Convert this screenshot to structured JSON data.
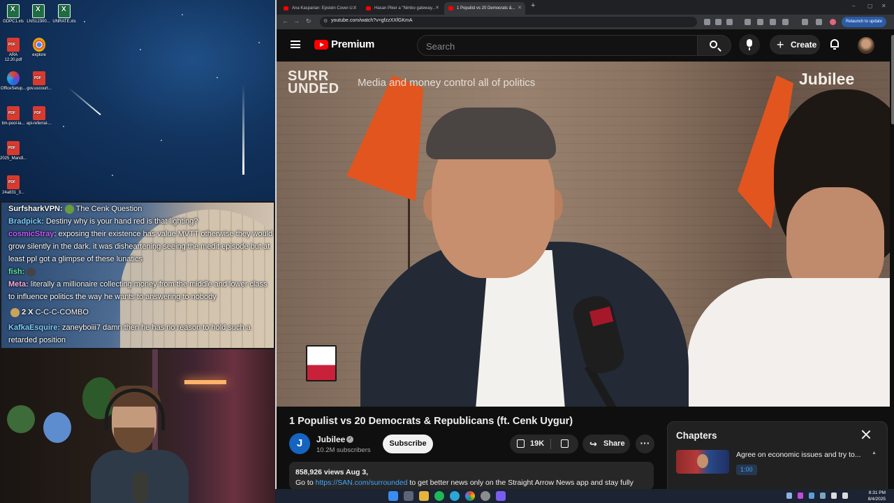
{
  "desktop": {
    "icons": [
      {
        "label": "GDPC1.xls",
        "type": "excel"
      },
      {
        "label": "LNS12300...",
        "type": "excel"
      },
      {
        "label": "UNRATE.xls",
        "type": "excel"
      },
      {
        "label": "ARA 12.20.pdf",
        "type": "pdf"
      },
      {
        "label": "explore",
        "type": "chrome"
      },
      {
        "label": "OfficeSetup...",
        "type": "office"
      },
      {
        "label": "gov.uscourt...",
        "type": "pdf"
      },
      {
        "label": "tim-pool-la...",
        "type": "pdf"
      },
      {
        "label": "api-referral-...",
        "type": "pdf"
      },
      {
        "label": "2025_Mandl...",
        "type": "pdf"
      },
      {
        "label": "24a831_3...",
        "type": "pdf"
      }
    ]
  },
  "chat": {
    "messages": [
      {
        "user": "SurfsharkVPN:",
        "user_color": "#ffffff",
        "text": "The Cenk Question",
        "emote": true
      },
      {
        "user": "Bradpick:",
        "user_color": "#7fd0ff",
        "text": "Destiny why is your hand red is that lighting?"
      },
      {
        "user": "cosmicStray",
        "user_color": "#c35cff",
        "text": ": exposing their existence has value MVTT otherwise they would grow silently in the dark. it was disheartening seeing the medit episode but at least ppl got a glimpse of these lunatics"
      },
      {
        "user": "fish:",
        "user_color": "#63e6a6",
        "text": "",
        "emote": true
      },
      {
        "user": "Meta:",
        "user_color": "#ffb0e0",
        "text": "literally a millionaire collecting money from the middle and lower class to influence politics the way he wants to answering to nobody"
      },
      {
        "user": "2 X",
        "user_color": "#ffffff",
        "text": "C-C-C-COMBO",
        "emote": true
      },
      {
        "user": "KafkaEsquire:",
        "user_color": "#7fd0ff",
        "text": "zaneyboiii7 damn then he has no reason to hold such a retarded position"
      }
    ]
  },
  "browser": {
    "tabs": [
      {
        "title": "Ana Kasparian: Epstein Cover-U...",
        "active": false
      },
      {
        "title": "Hasan Piker a \"Nimbo gateway...",
        "active": false
      },
      {
        "title": "1 Populist vs 20 Democrats &...",
        "active": true
      }
    ],
    "new_tab_label": "+",
    "url": "youtube.com/watch?v=gfzzXXfGKmA",
    "relaunch_label": "Relaunch to update"
  },
  "youtube": {
    "logo_text": "Premium",
    "search_placeholder": "Search",
    "create_label": "Create",
    "video": {
      "watermark_left": "SURR\nUNDED",
      "caption_overlay": "Media and money control all of politics",
      "watermark_right": "Jubilee",
      "mic_flag_text": "SURR UNDED"
    },
    "title": "1 Populist vs 20 Democrats & Republicans (ft. Cenk Uygur)",
    "channel": {
      "name": "Jubilee",
      "avatar_letter": "J",
      "subscribers": "10.2M subscribers"
    },
    "subscribe_label": "Subscribe",
    "likes": "19K",
    "share_label": "Share",
    "more_label": "···",
    "description": {
      "stats": "858,926 views  Aug 3,",
      "line_prefix": "Go to ",
      "link": "https://SAN.com/surrounded",
      "line_suffix": " to get better news only on the Straight Arrow News app and stay fully"
    },
    "chapters": {
      "title": "Chapters",
      "items": [
        {
          "title": "Agree on economic issues and try to...",
          "time": "1:00"
        }
      ]
    }
  },
  "taskbar": {
    "time": "8:31 PM",
    "date": "8/4/2025"
  }
}
